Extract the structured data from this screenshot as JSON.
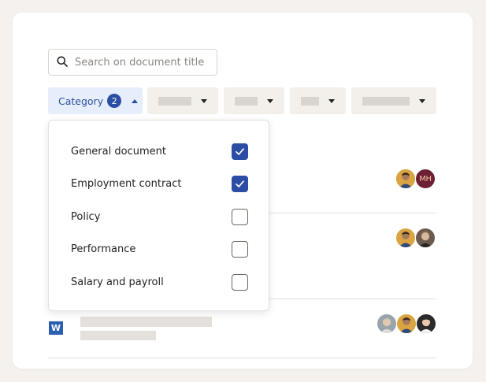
{
  "search": {
    "placeholder": "Search on document title"
  },
  "filters": {
    "category": {
      "label": "Category",
      "count": "2"
    }
  },
  "dropdown": {
    "options": [
      {
        "label": "General document",
        "checked": true
      },
      {
        "label": "Employment contract",
        "checked": true
      },
      {
        "label": "Policy",
        "checked": false
      },
      {
        "label": "Performance",
        "checked": false
      },
      {
        "label": "Salary and payroll",
        "checked": false
      }
    ]
  },
  "rows": {
    "row1": {
      "initials": "MH"
    },
    "row3": {
      "file_icon": "W"
    }
  },
  "colors": {
    "accent": "#2b4da3",
    "active_filter_bg": "#e6eefb",
    "filter_bg": "#f3f0ec",
    "page_bg": "#f4f1ee",
    "initials_avatar_bg": "#6d1f35"
  }
}
